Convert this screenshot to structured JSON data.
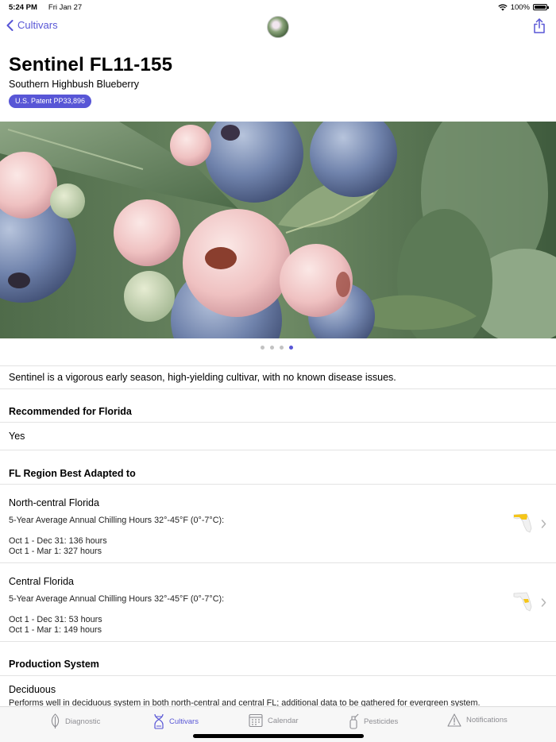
{
  "status": {
    "time": "5:24 PM",
    "date": "Fri Jan 27",
    "battery": "100%"
  },
  "nav": {
    "back_label": "Cultivars"
  },
  "header": {
    "title": "Sentinel FL11-155",
    "subtitle": "Southern Highbush Blueberry",
    "patent": "U.S. Patent PP33,896"
  },
  "gallery": {
    "page_count": 4,
    "current_page": 4
  },
  "description": "Sentinel is a vigorous early season, high-yielding cultivar, with no known disease issues.",
  "recommended": {
    "heading": "Recommended for Florida",
    "value": "Yes"
  },
  "regions": {
    "heading": "FL Region Best Adapted to",
    "items": [
      {
        "name": "North-central Florida",
        "chill_label": "5-Year Average Annual Chilling Hours 32°-45°F (0°-7°C):",
        "line1": "Oct 1 - Dec 31: 136 hours",
        "line2": "Oct 1 - Mar 1: 327 hours"
      },
      {
        "name": "Central Florida",
        "chill_label": "5-Year Average Annual Chilling Hours 32°-45°F (0°-7°C):",
        "line1": "Oct 1 - Dec 31: 53 hours",
        "line2": "Oct 1 - Mar 1: 149 hours"
      }
    ]
  },
  "production": {
    "heading": "Production System",
    "value": "Deciduous",
    "note": "Performs well in deciduous system in both north-central and central FL; additional data to be gathered for evergreen system."
  },
  "tabs": [
    {
      "label": "Diagnostic",
      "icon": "leaf-icon",
      "active": false
    },
    {
      "label": "Cultivars",
      "icon": "dna-icon",
      "active": true
    },
    {
      "label": "Calendar",
      "icon": "calendar-icon",
      "active": false
    },
    {
      "label": "Pesticides",
      "icon": "pesticide-icon",
      "active": false
    },
    {
      "label": "Notifications",
      "icon": "warning-icon",
      "active": false
    }
  ],
  "colors": {
    "accent": "#5856d6",
    "divider": "#e3e3e3",
    "tab_inactive": "#8e8e93",
    "florida_highlight": "#f5c518"
  }
}
